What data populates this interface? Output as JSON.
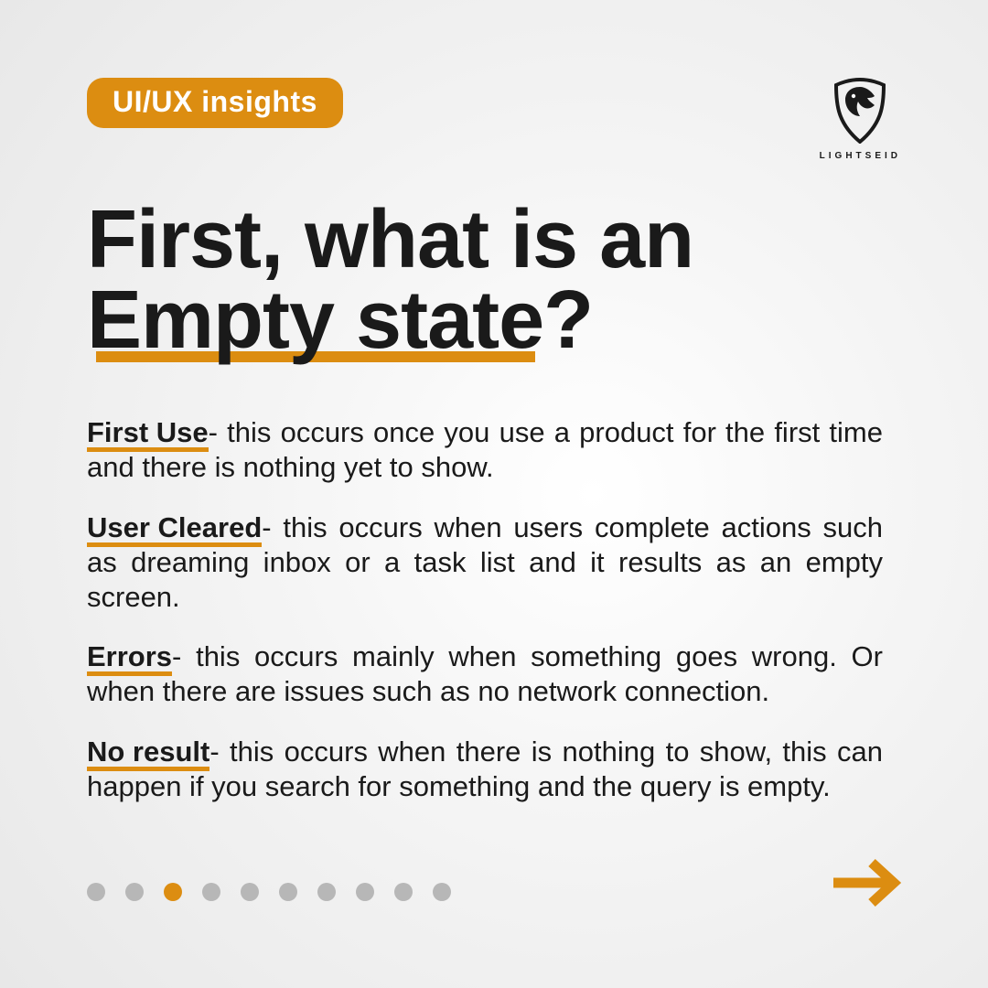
{
  "header": {
    "badge": "UI/UX insights",
    "brand": "LIGHTSEID"
  },
  "title": "First, what is an Empty state?",
  "items": [
    {
      "term": "First Use",
      "text": "- this occurs once you use a product for the first time and there is nothing yet to show."
    },
    {
      "term": "User Cleared",
      "text": "- this occurs when users complete ac­tions such as dreaming inbox or a task list and it re­sults as an empty screen."
    },
    {
      "term": "Errors",
      "text": "- this occurs mainly when something goes wrong. Or when there are issues such as no network connection."
    },
    {
      "term": "No result",
      "text": "- this occurs when there is nothing to show, this can happen if you search for something and the query is empty."
    }
  ],
  "pagination": {
    "total": 10,
    "active_index": 2
  },
  "colors": {
    "accent": "#dc8d11",
    "muted": "#b7b7b7",
    "text": "#1a1a1a"
  }
}
